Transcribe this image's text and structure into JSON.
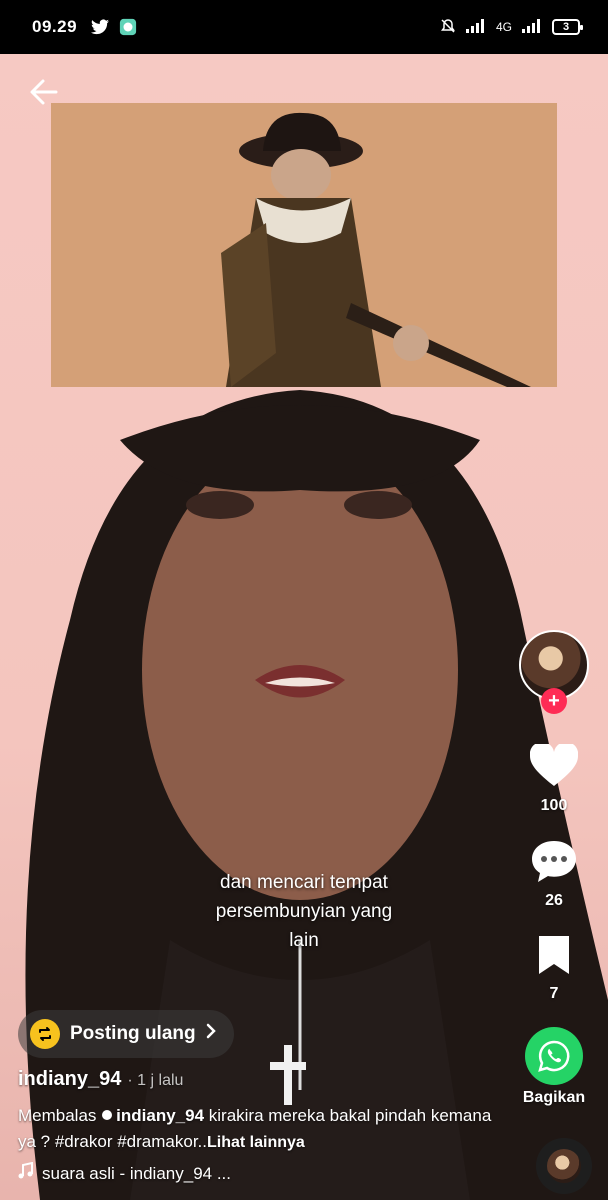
{
  "status": {
    "time": "09.29",
    "network": "4G",
    "battery": "3"
  },
  "video": {
    "caption_line1": "dan mencari tempat",
    "caption_line2": "persembunyian yang",
    "caption_line3": "lain"
  },
  "actions": {
    "like_count": "100",
    "comment_count": "26",
    "bookmark_count": "7",
    "share_label": "Bagikan"
  },
  "repost": {
    "label": "Posting ulang"
  },
  "post": {
    "username": "indiany_94",
    "time_ago": "· 1 j lalu",
    "reply_prefix": "Membalas",
    "reply_user": "indiany_94",
    "desc_text": "kirakira mereka bakal pindah kemana ya ? #drakor #dramakor..",
    "see_more": "Lihat lainnya",
    "sound": "suara asli - indiany_94 ..."
  },
  "icons": {
    "back": "arrow-left-icon",
    "like": "heart-icon",
    "comment": "comment-icon",
    "bookmark": "bookmark-icon",
    "share": "whatsapp-icon",
    "music": "music-note-icon"
  }
}
